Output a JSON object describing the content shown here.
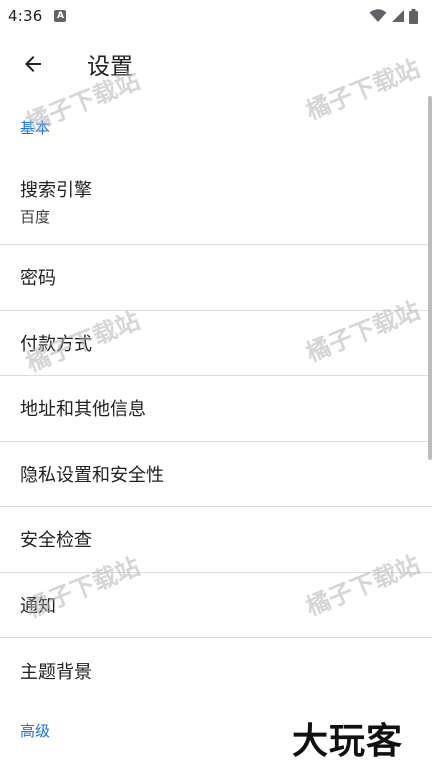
{
  "status_bar": {
    "time": "4:36",
    "notification_badge": "A",
    "icons": [
      "wifi-icon",
      "signal-icon",
      "battery-icon"
    ]
  },
  "toolbar": {
    "back_icon": "arrow-back-icon",
    "title": "设置"
  },
  "sections": {
    "basic": {
      "label": "基本"
    },
    "advanced": {
      "label": "高级"
    }
  },
  "items": {
    "search_engine": {
      "title": "搜索引擎",
      "subtitle": "百度"
    },
    "passwords": {
      "title": "密码"
    },
    "payment": {
      "title": "付款方式"
    },
    "addresses": {
      "title": "地址和其他信息"
    },
    "privacy": {
      "title": "隐私设置和安全性"
    },
    "safety_check": {
      "title": "安全检查"
    },
    "notifications": {
      "title": "通知"
    },
    "theme": {
      "title": "主题背景"
    }
  },
  "watermark": {
    "text": "橘子下载站"
  },
  "brand": {
    "text": "大玩客"
  },
  "colors": {
    "accent": "#1a73e8",
    "divider": "#dadce0",
    "text_primary": "#202124"
  }
}
